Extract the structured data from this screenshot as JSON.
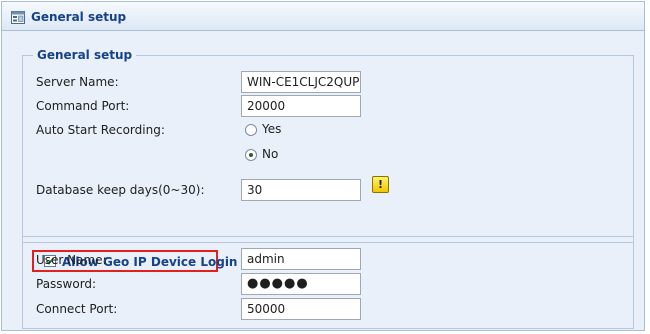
{
  "header": {
    "title": "General setup",
    "icon": "panel-icon"
  },
  "general": {
    "legend": "General setup",
    "server_name_label": "Server Name:",
    "server_name_value": "WIN-CE1CLJC2QUP",
    "command_port_label": "Command Port:",
    "command_port_value": "20000",
    "auto_start_label": "Auto Start Recording:",
    "auto_start_options": [
      "Yes",
      "No"
    ],
    "auto_start_selected": "No",
    "db_keep_label": "Database keep days(0~30):",
    "db_keep_value": "30",
    "help_icon": "help-icon"
  },
  "geo": {
    "checkbox_label": "Allow Geo IP Device Login",
    "checked": true,
    "highlight_color": "#e0211f",
    "username_label": "User Name:",
    "username_value": "admin",
    "password_label": "Password:",
    "password_value": "●●●●●",
    "connect_port_label": "Connect Port:",
    "connect_port_value": "50000"
  },
  "colors": {
    "accent": "#15428b",
    "panel_bg": "#e9f0f9",
    "border": "#a9bfd6"
  }
}
